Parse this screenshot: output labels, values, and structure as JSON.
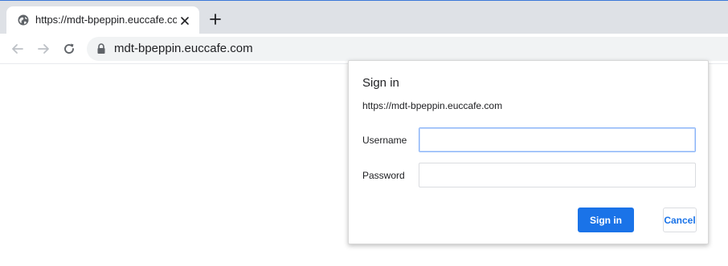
{
  "tab": {
    "title": "https://mdt-bpeppin.euccafe.com",
    "favicon": "globe-icon",
    "close_icon": "close-icon"
  },
  "new_tab_icon": "plus-icon",
  "toolbar": {
    "back_icon": "arrow-left-icon",
    "forward_icon": "arrow-right-icon",
    "reload_icon": "reload-icon",
    "lock_icon": "lock-icon",
    "url": "mdt-bpeppin.euccafe.com"
  },
  "dialog": {
    "title": "Sign in",
    "origin": "https://mdt-bpeppin.euccafe.com",
    "username_label": "Username",
    "username_value": "",
    "password_label": "Password",
    "password_value": "",
    "signin_label": "Sign in",
    "cancel_label": "Cancel"
  },
  "colors": {
    "tabstrip": "#dee1e6",
    "omnibox": "#f1f3f4",
    "accent": "#1a73e8",
    "focus_border": "#8ab4f8"
  }
}
